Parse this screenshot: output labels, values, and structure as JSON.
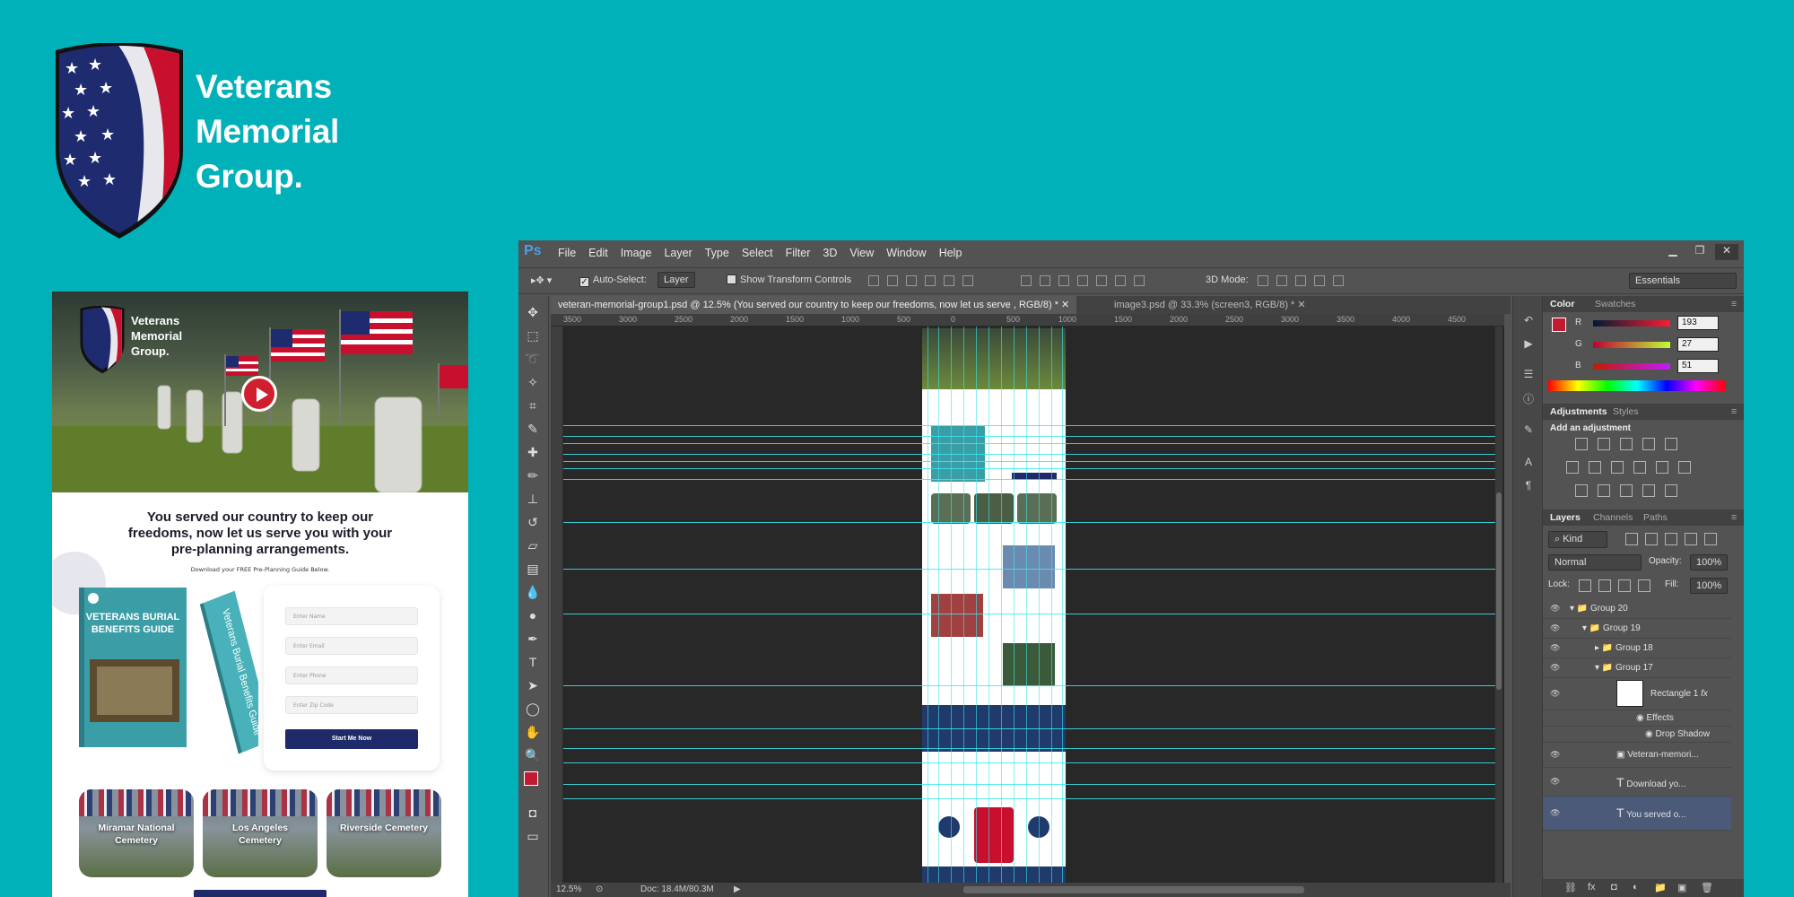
{
  "brand": {
    "line1": "Veterans",
    "line2": "Memorial",
    "line3": "Group."
  },
  "landing": {
    "mini_brand_line1": "Veterans",
    "mini_brand_line2": "Memorial",
    "mini_brand_line3": "Group.",
    "headline_line1": "You served our country to keep our",
    "headline_line2": "freedoms, now let us serve you with your",
    "headline_line3": "pre-planning arrangements.",
    "subline": "Download your FREE Pre-Planning Guide Below.",
    "book_cover_title_1": "VETERANS BURIAL",
    "book_cover_title_2": "BENEFITS GUIDE",
    "book_spine_title": "Veterans Burial Benefits Guide",
    "form": {
      "name_placeholder": "Enter Name",
      "email_placeholder": "Enter Email",
      "phone_placeholder": "Enter Phone",
      "zip_placeholder": "Enter Zip Code",
      "submit_label": "Start Me Now"
    },
    "cemeteries": [
      {
        "line1": "Miramar National",
        "line2": "Cemetery"
      },
      {
        "line1": "Los Angeles",
        "line2": "Cemetery"
      },
      {
        "line1": "Riverside Cemetery",
        "line2": ""
      }
    ]
  },
  "photoshop": {
    "logo": "Ps",
    "menu": [
      "File",
      "Edit",
      "Image",
      "Layer",
      "Type",
      "Select",
      "Filter",
      "3D",
      "View",
      "Window",
      "Help"
    ],
    "options": {
      "auto_select_label": "Auto-Select:",
      "auto_select_value": "Layer",
      "transform_label": "Show Transform Controls",
      "mode_3d_label": "3D Mode:",
      "workspace": "Essentials"
    },
    "tabs": [
      {
        "label": "veteran-memorial-group1.psd @ 12.5% (You served our country to keep our  freedoms, now let us serve , RGB/8) *",
        "active": true
      },
      {
        "label": "image3.psd @ 33.3% (screen3, RGB/8) *",
        "active": false
      }
    ],
    "ruler_ticks": [
      "3500",
      "3000",
      "2500",
      "2000",
      "1500",
      "1000",
      "500",
      "0",
      "500",
      "1000",
      "1500",
      "2000",
      "2500",
      "3000",
      "3500",
      "4000",
      "4500"
    ],
    "status": {
      "zoom": "12.5%",
      "doc_size": "Doc: 18.4M/80.3M"
    },
    "color_panel": {
      "tab_color": "Color",
      "tab_swatches": "Swatches",
      "r_label": "R",
      "r_value": "193",
      "g_label": "G",
      "g_value": "27",
      "b_label": "B",
      "b_value": "51",
      "foreground_color": "#c11b33"
    },
    "adjustments_panel": {
      "tab_adjustments": "Adjustments",
      "tab_styles": "Styles",
      "heading": "Add an adjustment"
    },
    "layers_panel": {
      "tab_layers": "Layers",
      "tab_channels": "Channels",
      "tab_paths": "Paths",
      "kind": "Kind",
      "blend_mode": "Normal",
      "opacity_label": "Opacity:",
      "opacity_value": "100%",
      "lock_label": "Lock:",
      "fill_label": "Fill:",
      "fill_value": "100%",
      "layers": [
        {
          "name": "Group 20"
        },
        {
          "name": "Group 19"
        },
        {
          "name": "Group 18"
        },
        {
          "name": "Group 17"
        },
        {
          "name": "Rectangle 1"
        },
        {
          "name": "Effects"
        },
        {
          "name": "Drop Shadow"
        },
        {
          "name": "Veteran-memori..."
        },
        {
          "name": "Download yo..."
        },
        {
          "name": "You served o..."
        }
      ]
    }
  }
}
